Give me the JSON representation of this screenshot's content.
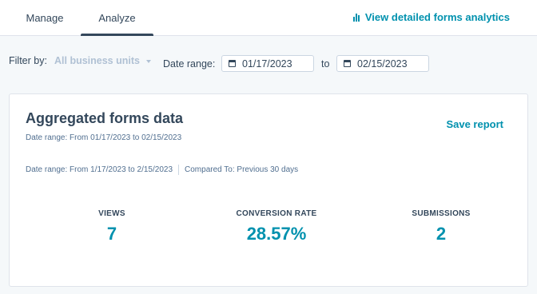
{
  "tabs": [
    {
      "label": "Manage"
    },
    {
      "label": "Analyze"
    }
  ],
  "header": {
    "analytics_link": "View detailed forms analytics"
  },
  "filters": {
    "filter_by_label": "Filter by:",
    "business_units": "All business units",
    "date_range_label": "Date range:",
    "start_date": "01/17/2023",
    "to_label": "to",
    "end_date": "02/15/2023"
  },
  "card": {
    "title": "Aggregated forms data",
    "save_report": "Save report",
    "date_range_sub": "Date range: From 01/17/2023 to 02/15/2023",
    "meta_range": "Date range: From 1/17/2023 to 2/15/2023",
    "meta_compare": "Compared To: Previous 30 days",
    "stats": [
      {
        "label": "VIEWS",
        "value": "7"
      },
      {
        "label": "CONVERSION RATE",
        "value": "28.57%"
      },
      {
        "label": "SUBMISSIONS",
        "value": "2"
      }
    ]
  },
  "colors": {
    "accent": "#0091ae",
    "text": "#33475b",
    "muted": "#b0c1d4",
    "background": "#f5f8fa"
  },
  "icons": {
    "analytics": "bar-chart-icon",
    "calendar": "calendar-icon",
    "dropdown": "caret-down-icon"
  }
}
